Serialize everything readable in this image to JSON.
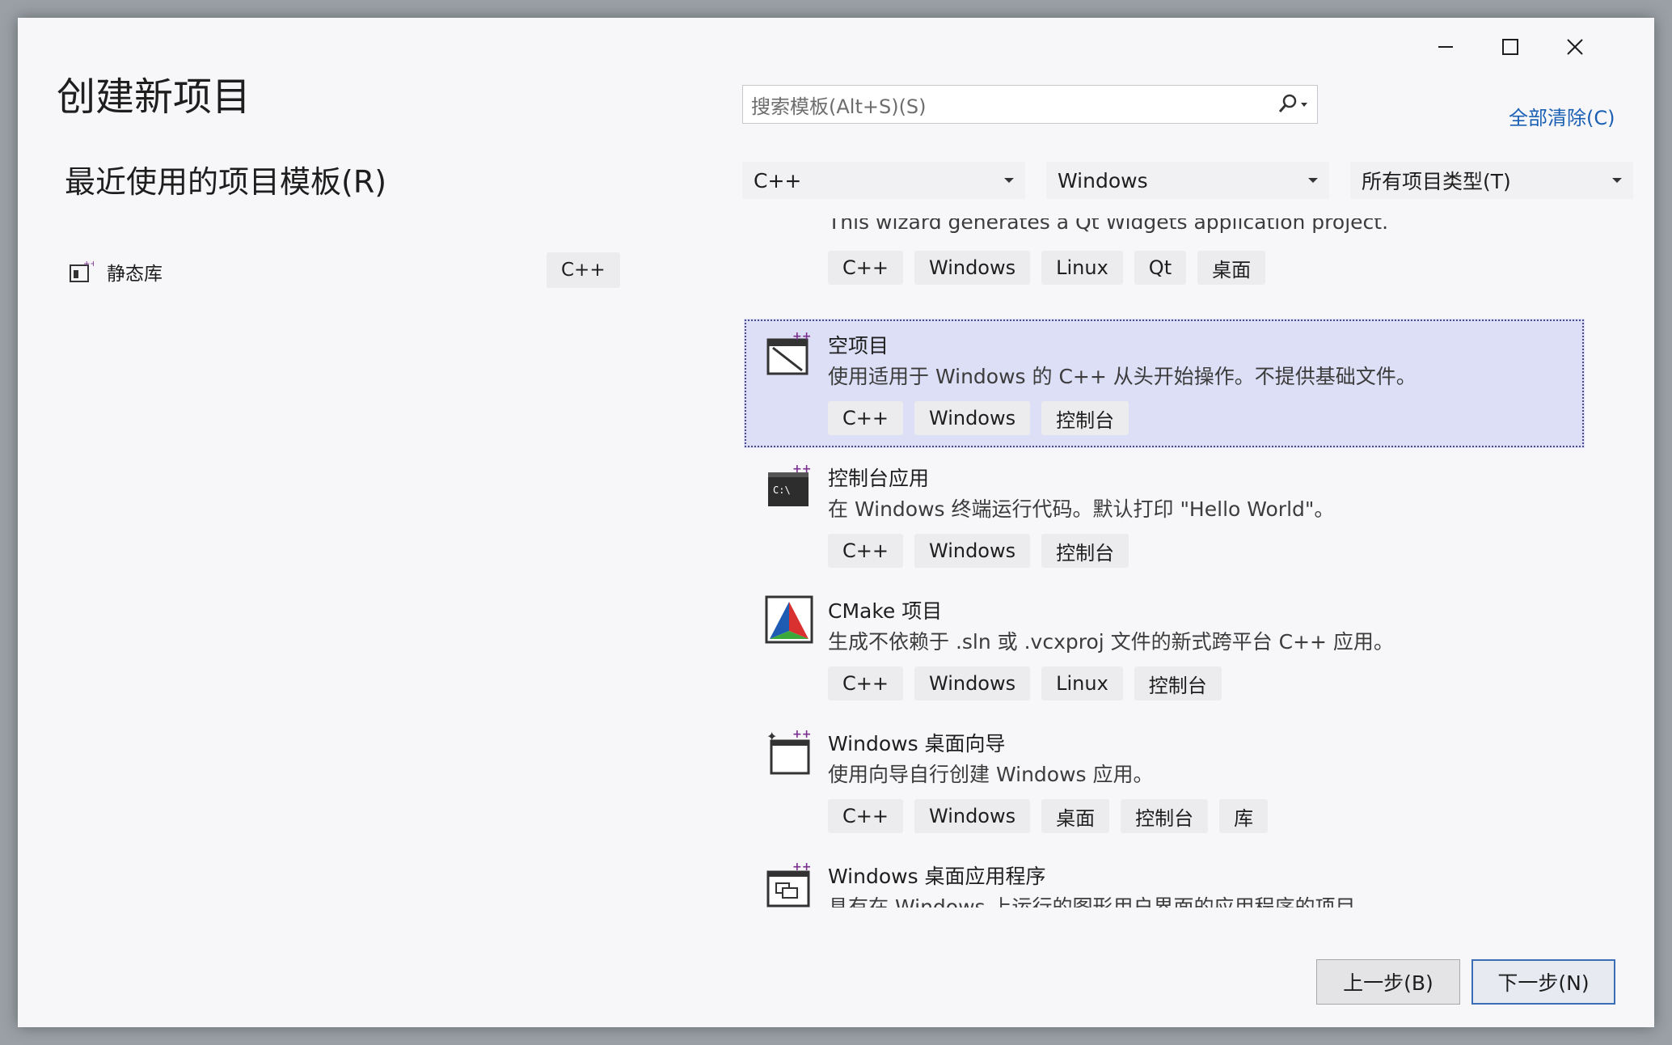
{
  "window": {
    "title": "创建新项目",
    "caption": {
      "minimize": "—",
      "maximize": "☐",
      "close": "✕"
    }
  },
  "recent": {
    "heading": "最近使用的项目模板(R)",
    "items": [
      {
        "label": "静态库",
        "tag": "C++"
      }
    ]
  },
  "search": {
    "placeholder": "搜索模板(Alt+S)(S)",
    "icon": "search-icon"
  },
  "clear_all": "全部清除(C)",
  "filters": {
    "language": "C++",
    "platform": "Windows",
    "project_type": "所有项目类型(T)"
  },
  "templates": [
    {
      "name": "",
      "desc": "This wizard generates a Qt Widgets application project.",
      "tags": [
        "C++",
        "Windows",
        "Linux",
        "Qt",
        "桌面"
      ],
      "icon": "qt-icon",
      "selected": false
    },
    {
      "name": "空项目",
      "desc": "使用适用于 Windows 的 C++ 从头开始操作。不提供基础文件。",
      "tags": [
        "C++",
        "Windows",
        "控制台"
      ],
      "icon": "empty-project-icon",
      "selected": true
    },
    {
      "name": "控制台应用",
      "desc": "在 Windows 终端运行代码。默认打印 \"Hello World\"。",
      "tags": [
        "C++",
        "Windows",
        "控制台"
      ],
      "icon": "console-app-icon",
      "selected": false
    },
    {
      "name": "CMake 项目",
      "desc": "生成不依赖于 .sln 或 .vcxproj 文件的新式跨平台 C++ 应用。",
      "tags": [
        "C++",
        "Windows",
        "Linux",
        "控制台"
      ],
      "icon": "cmake-icon",
      "selected": false
    },
    {
      "name": "Windows 桌面向导",
      "desc": "使用向导自行创建 Windows 应用。",
      "tags": [
        "C++",
        "Windows",
        "桌面",
        "控制台",
        "库"
      ],
      "icon": "desktop-wizard-icon",
      "selected": false
    },
    {
      "name": "Windows 桌面应用程序",
      "desc": "具有在 Windows 上运行的图形用户界面的应用程序的项目。",
      "tags": [],
      "icon": "desktop-app-icon",
      "selected": false
    }
  ],
  "buttons": {
    "back": "上一步(B)",
    "next": "下一步(N)"
  },
  "colors": {
    "selected_bg": "#dcdff6",
    "link": "#1a5fb4",
    "accent": "#3a6fb8",
    "tag_bg": "#ececee"
  }
}
